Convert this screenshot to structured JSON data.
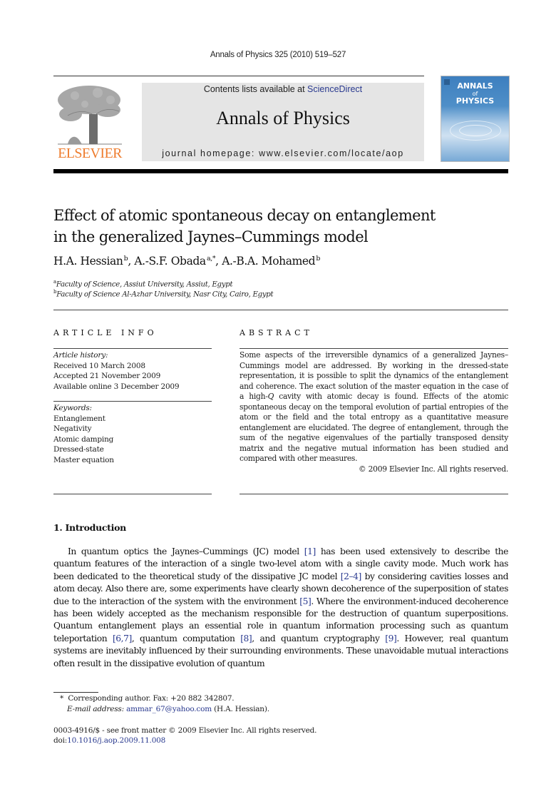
{
  "running_head": "Annals of Physics 325 (2010) 519–527",
  "masthead": {
    "publisher_wordmark": "ELSEVIER",
    "publisher_logo_icon": "elsevier-tree-icon",
    "contents_prefix": "Contents lists available at ",
    "contents_link": "ScienceDirect",
    "journal_name": "Annals of Physics",
    "homepage_label": "journal homepage: ",
    "homepage_url": "www.elsevier.com/locate/aop",
    "cover": {
      "title_line1": "ANNALS",
      "title_line2": "of",
      "title_line3": "PHYSICS",
      "colors": {
        "top": "#3d7fbf",
        "bottom": "#77a9d6"
      }
    },
    "brand_color": "#ee7d2f",
    "link_color": "#2a3a8f"
  },
  "article": {
    "title_line1": "Effect of atomic spontaneous decay on entanglement",
    "title_line2": "in the generalized Jaynes–Cummings model",
    "authors": [
      {
        "name": "H.A. Hessian",
        "affil": "b"
      },
      {
        "name": "A.-S.F. Obada",
        "affil": "a,*"
      },
      {
        "name": "A.-B.A. Mohamed",
        "affil": "b"
      }
    ],
    "affiliations": [
      {
        "mark": "a",
        "text": "Faculty of Science, Assiut University, Assiut, Egypt"
      },
      {
        "mark": "b",
        "text": "Faculty of Science Al-Azhar University, Nasr City, Cairo, Egypt"
      }
    ]
  },
  "article_info": {
    "heading": "ARTICLE INFO",
    "history_label": "Article history:",
    "history": [
      "Received 10 March 2008",
      "Accepted 21 November 2009",
      "Available online 3 December 2009"
    ],
    "keywords_label": "Keywords:",
    "keywords": [
      "Entanglement",
      "Negativity",
      "Atomic damping",
      "Dressed-state",
      "Master equation"
    ]
  },
  "abstract": {
    "heading": "ABSTRACT",
    "text_before_q": "Some aspects of the irreversible dynamics of a generalized Jaynes–Cummings model are addressed. By working in the dressed-state representation, it is possible to split the dynamics of the entanglement and coherence. The exact solution of the master equation in the case of a high-",
    "q_symbol": "Q",
    "text_after_q": " cavity with atomic decay is found. Effects of the atomic spontaneous decay on the temporal evolution of partial entropies of the atom or the field and the total entropy as a quantitative measure entanglement are elucidated. The degree of entanglement, through the sum of the negative eigenvalues of the partially transposed density matrix and the negative mutual information has been studied and compared with other measures.",
    "copyright": "© 2009 Elsevier Inc. All rights reserved."
  },
  "introduction": {
    "heading": "1. Introduction",
    "segments": [
      {
        "t": "In quantum optics the Jaynes–Cummings (JC) model "
      },
      {
        "ref": "[1]"
      },
      {
        "t": " has been used extensively to describe the quantum features of the interaction of a single two-level atom with a single cavity mode. Much work has been dedicated to the theoretical study of the dissipative JC model "
      },
      {
        "ref": "[2–4]"
      },
      {
        "t": " by considering cavities losses and atom decay. Also there are, some experiments have clearly shown decoherence of the superposition of states due to the interaction of the system with the environment "
      },
      {
        "ref": "[5]"
      },
      {
        "t": ". Where the environment-induced decoherence has been widely accepted as the mechanism responsible for the destruction of quantum superpositions. Quantum entanglement plays an essential role in quantum information processing such as quantum teleportation "
      },
      {
        "ref": "[6,7]"
      },
      {
        "t": ", quantum computation "
      },
      {
        "ref": "[8]"
      },
      {
        "t": ", and quantum cryptography "
      },
      {
        "ref": "[9]"
      },
      {
        "t": ". However, real quantum systems are inevitably influenced by their surrounding environments. These unavoidable mutual interactions often result in the dissipative evolution of quantum"
      }
    ]
  },
  "footnotes": {
    "corresponding_mark": "*",
    "corresponding_text": "Corresponding author. Fax: +20 882 342807.",
    "email_label": "E-mail address:",
    "email": "ammar_67@yahoo.com",
    "email_owner": "(H.A. Hessian)."
  },
  "footer": {
    "issn_line": "0003-4916/$ - see front matter © 2009 Elsevier Inc. All rights reserved.",
    "doi_prefix": "doi:",
    "doi": "10.1016/j.aop.2009.11.008"
  }
}
